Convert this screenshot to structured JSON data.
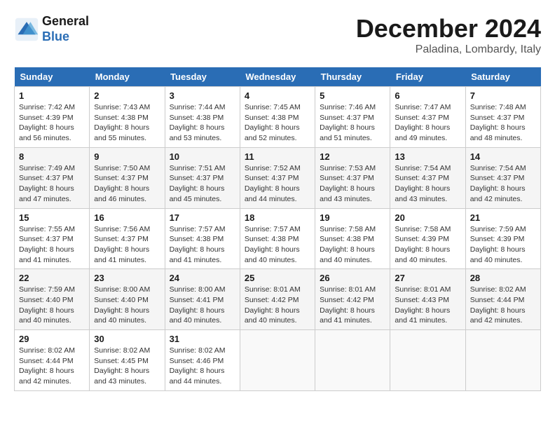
{
  "header": {
    "logo_line1": "General",
    "logo_line2": "Blue",
    "month_title": "December 2024",
    "location": "Paladina, Lombardy, Italy"
  },
  "weekdays": [
    "Sunday",
    "Monday",
    "Tuesday",
    "Wednesday",
    "Thursday",
    "Friday",
    "Saturday"
  ],
  "weeks": [
    [
      {
        "day": "1",
        "sunrise": "7:42 AM",
        "sunset": "4:39 PM",
        "daylight": "8 hours and 56 minutes."
      },
      {
        "day": "2",
        "sunrise": "7:43 AM",
        "sunset": "4:38 PM",
        "daylight": "8 hours and 55 minutes."
      },
      {
        "day": "3",
        "sunrise": "7:44 AM",
        "sunset": "4:38 PM",
        "daylight": "8 hours and 53 minutes."
      },
      {
        "day": "4",
        "sunrise": "7:45 AM",
        "sunset": "4:38 PM",
        "daylight": "8 hours and 52 minutes."
      },
      {
        "day": "5",
        "sunrise": "7:46 AM",
        "sunset": "4:37 PM",
        "daylight": "8 hours and 51 minutes."
      },
      {
        "day": "6",
        "sunrise": "7:47 AM",
        "sunset": "4:37 PM",
        "daylight": "8 hours and 49 minutes."
      },
      {
        "day": "7",
        "sunrise": "7:48 AM",
        "sunset": "4:37 PM",
        "daylight": "8 hours and 48 minutes."
      }
    ],
    [
      {
        "day": "8",
        "sunrise": "7:49 AM",
        "sunset": "4:37 PM",
        "daylight": "8 hours and 47 minutes."
      },
      {
        "day": "9",
        "sunrise": "7:50 AM",
        "sunset": "4:37 PM",
        "daylight": "8 hours and 46 minutes."
      },
      {
        "day": "10",
        "sunrise": "7:51 AM",
        "sunset": "4:37 PM",
        "daylight": "8 hours and 45 minutes."
      },
      {
        "day": "11",
        "sunrise": "7:52 AM",
        "sunset": "4:37 PM",
        "daylight": "8 hours and 44 minutes."
      },
      {
        "day": "12",
        "sunrise": "7:53 AM",
        "sunset": "4:37 PM",
        "daylight": "8 hours and 43 minutes."
      },
      {
        "day": "13",
        "sunrise": "7:54 AM",
        "sunset": "4:37 PM",
        "daylight": "8 hours and 43 minutes."
      },
      {
        "day": "14",
        "sunrise": "7:54 AM",
        "sunset": "4:37 PM",
        "daylight": "8 hours and 42 minutes."
      }
    ],
    [
      {
        "day": "15",
        "sunrise": "7:55 AM",
        "sunset": "4:37 PM",
        "daylight": "8 hours and 41 minutes."
      },
      {
        "day": "16",
        "sunrise": "7:56 AM",
        "sunset": "4:37 PM",
        "daylight": "8 hours and 41 minutes."
      },
      {
        "day": "17",
        "sunrise": "7:57 AM",
        "sunset": "4:38 PM",
        "daylight": "8 hours and 41 minutes."
      },
      {
        "day": "18",
        "sunrise": "7:57 AM",
        "sunset": "4:38 PM",
        "daylight": "8 hours and 40 minutes."
      },
      {
        "day": "19",
        "sunrise": "7:58 AM",
        "sunset": "4:38 PM",
        "daylight": "8 hours and 40 minutes."
      },
      {
        "day": "20",
        "sunrise": "7:58 AM",
        "sunset": "4:39 PM",
        "daylight": "8 hours and 40 minutes."
      },
      {
        "day": "21",
        "sunrise": "7:59 AM",
        "sunset": "4:39 PM",
        "daylight": "8 hours and 40 minutes."
      }
    ],
    [
      {
        "day": "22",
        "sunrise": "7:59 AM",
        "sunset": "4:40 PM",
        "daylight": "8 hours and 40 minutes."
      },
      {
        "day": "23",
        "sunrise": "8:00 AM",
        "sunset": "4:40 PM",
        "daylight": "8 hours and 40 minutes."
      },
      {
        "day": "24",
        "sunrise": "8:00 AM",
        "sunset": "4:41 PM",
        "daylight": "8 hours and 40 minutes."
      },
      {
        "day": "25",
        "sunrise": "8:01 AM",
        "sunset": "4:42 PM",
        "daylight": "8 hours and 40 minutes."
      },
      {
        "day": "26",
        "sunrise": "8:01 AM",
        "sunset": "4:42 PM",
        "daylight": "8 hours and 41 minutes."
      },
      {
        "day": "27",
        "sunrise": "8:01 AM",
        "sunset": "4:43 PM",
        "daylight": "8 hours and 41 minutes."
      },
      {
        "day": "28",
        "sunrise": "8:02 AM",
        "sunset": "4:44 PM",
        "daylight": "8 hours and 42 minutes."
      }
    ],
    [
      {
        "day": "29",
        "sunrise": "8:02 AM",
        "sunset": "4:44 PM",
        "daylight": "8 hours and 42 minutes."
      },
      {
        "day": "30",
        "sunrise": "8:02 AM",
        "sunset": "4:45 PM",
        "daylight": "8 hours and 43 minutes."
      },
      {
        "day": "31",
        "sunrise": "8:02 AM",
        "sunset": "4:46 PM",
        "daylight": "8 hours and 44 minutes."
      },
      null,
      null,
      null,
      null
    ]
  ]
}
